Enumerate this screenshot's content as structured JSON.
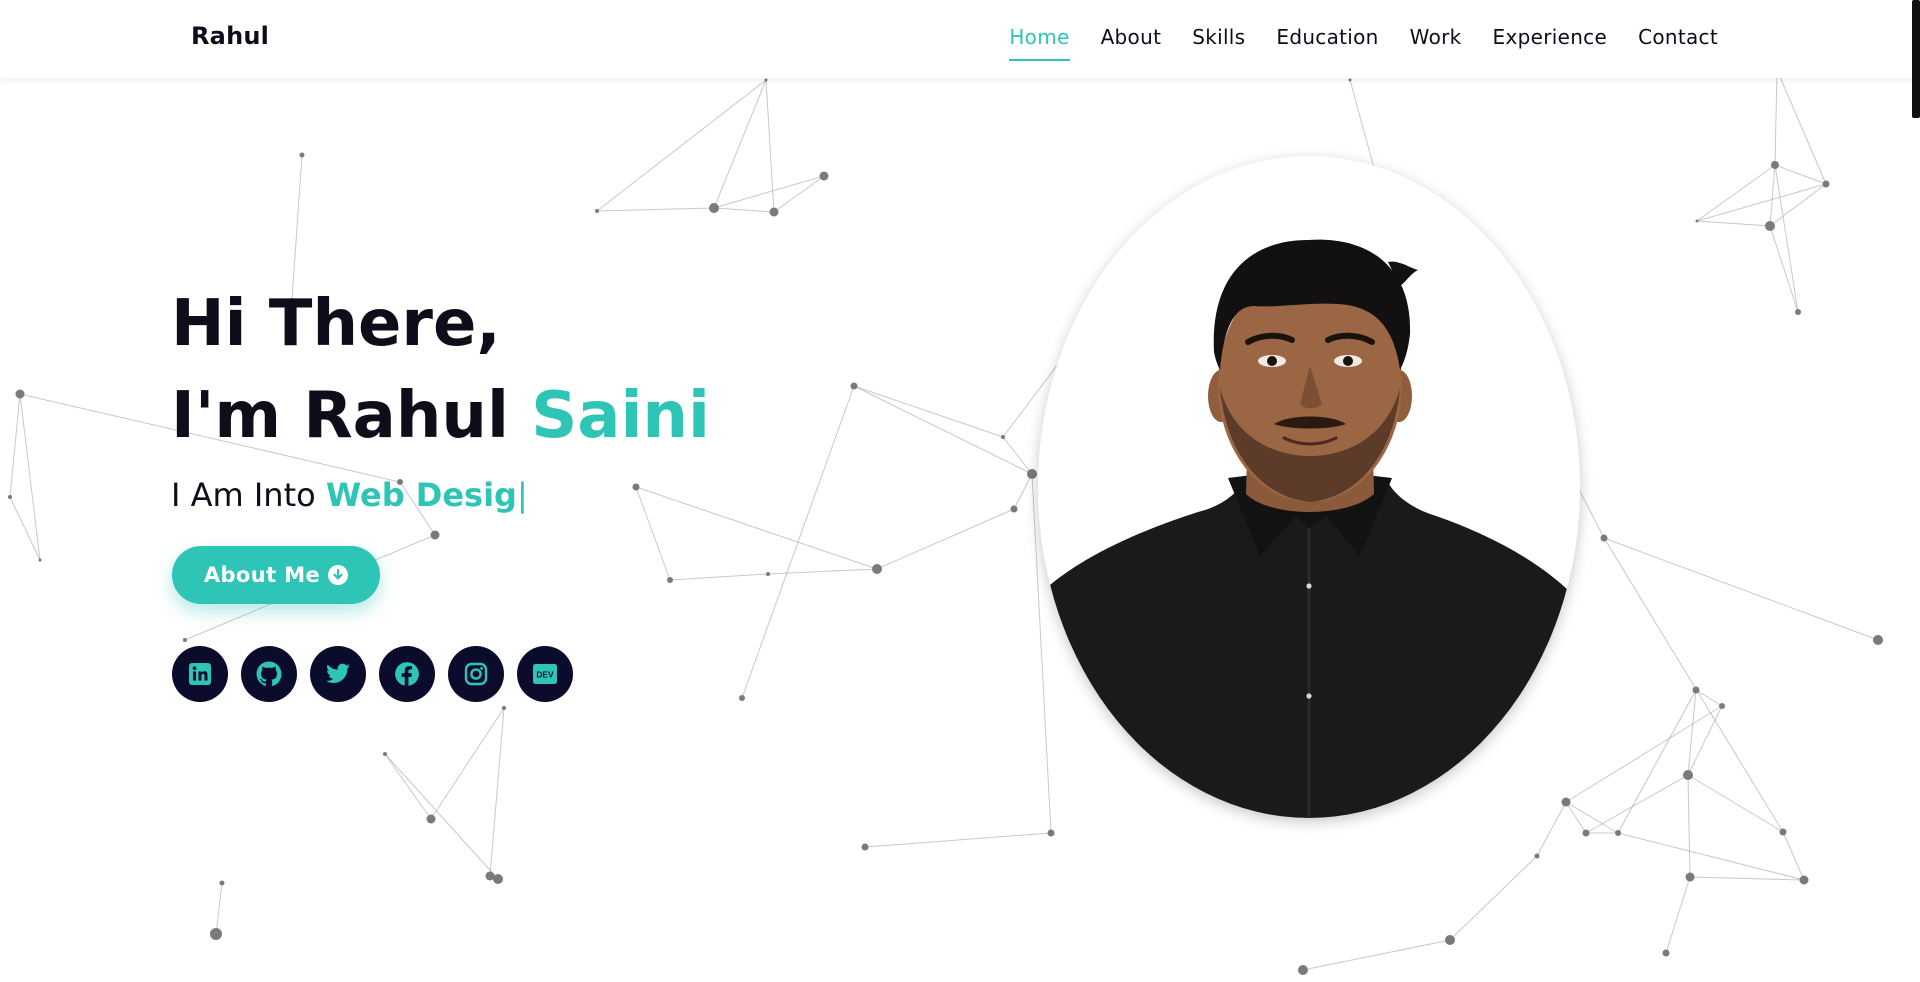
{
  "header": {
    "brand": "Rahul",
    "nav": [
      {
        "label": "Home",
        "active": true
      },
      {
        "label": "About"
      },
      {
        "label": "Skills"
      },
      {
        "label": "Education"
      },
      {
        "label": "Work"
      },
      {
        "label": "Experience"
      },
      {
        "label": "Contact"
      }
    ]
  },
  "hero": {
    "greeting": "Hi There,",
    "intro_prefix": "I'm Rahul",
    "intro_accent": "Saini",
    "typing_prefix": "I Am Into",
    "typing_word": "Web Desig",
    "caret": "|",
    "button_label": "About Me",
    "button_icon": "arrow-circle-down-icon"
  },
  "socials": [
    {
      "name": "linkedin-icon"
    },
    {
      "name": "github-icon"
    },
    {
      "name": "twitter-icon"
    },
    {
      "name": "facebook-icon"
    },
    {
      "name": "instagram-icon"
    },
    {
      "name": "dev-icon",
      "text": "DEV"
    }
  ],
  "colors": {
    "accent": "#2ec4b6",
    "text": "#0e0e1a",
    "social_bg": "#0b0b2b",
    "background": "#ffffff"
  },
  "portrait": {
    "image": "profile-photo"
  }
}
